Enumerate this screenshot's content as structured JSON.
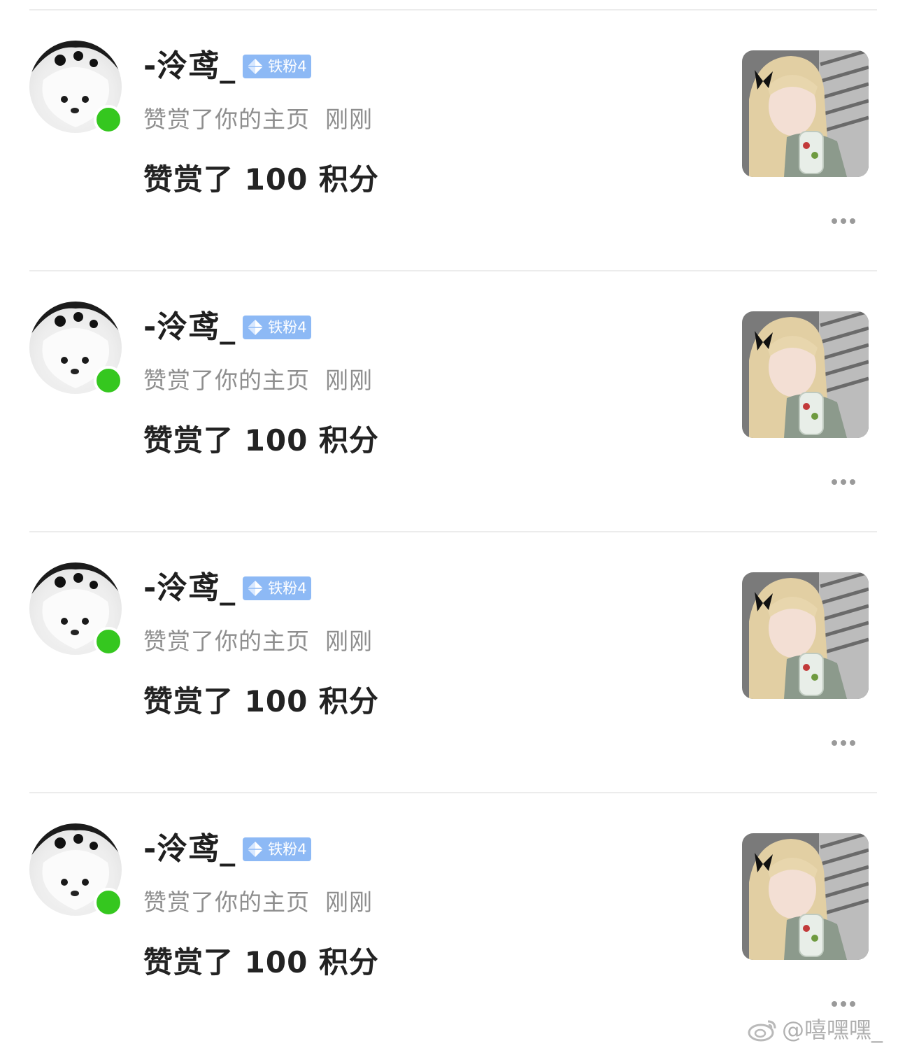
{
  "notifications": [
    {
      "username": "-泠鸢_",
      "badge": "铁粉4",
      "action": "赞赏了你的主页",
      "time": "刚刚",
      "content": "赞赏了 100 积分"
    },
    {
      "username": "-泠鸢_",
      "badge": "铁粉4",
      "action": "赞赏了你的主页",
      "time": "刚刚",
      "content": "赞赏了 100 积分"
    },
    {
      "username": "-泠鸢_",
      "badge": "铁粉4",
      "action": "赞赏了你的主页",
      "time": "刚刚",
      "content": "赞赏了 100 积分"
    },
    {
      "username": "-泠鸢_",
      "badge": "铁粉4",
      "action": "赞赏了你的主页",
      "time": "刚刚",
      "content": "赞赏了 100 积分"
    }
  ],
  "watermark": {
    "text": "@嘻嘿嘿_",
    "icon": "weibo-logo-icon"
  },
  "colors": {
    "online": "#35c71f",
    "badge": "#8db9f5",
    "meta_text": "#8e8e8e",
    "divider": "#ececec"
  }
}
